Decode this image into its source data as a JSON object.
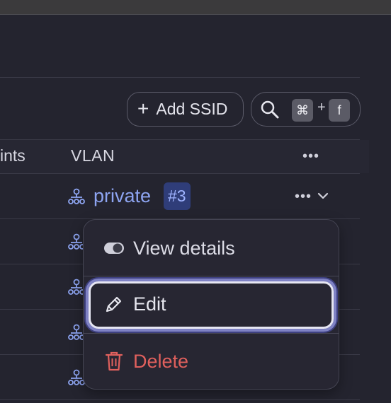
{
  "toolbar": {
    "add_ssid_label": "Add SSID",
    "shortcut_cmd": "⌘",
    "shortcut_plus": "+",
    "shortcut_key": "f"
  },
  "table": {
    "columns": {
      "partial_left": "ints",
      "vlan": "VLAN",
      "more": "•••"
    },
    "row1": {
      "vlan_name": "private",
      "vlan_badge": "#3",
      "more": "•••"
    }
  },
  "context_menu": {
    "items": [
      {
        "label": "View details",
        "icon": "toggle-icon"
      },
      {
        "label": "Edit",
        "icon": "pencil-icon"
      },
      {
        "label": "Delete",
        "icon": "trash-icon"
      }
    ]
  },
  "colors": {
    "link": "#8ea5f2",
    "badge_bg": "#2f3d79",
    "danger": "#e0605d",
    "focus_ring": "#7f82c4"
  }
}
